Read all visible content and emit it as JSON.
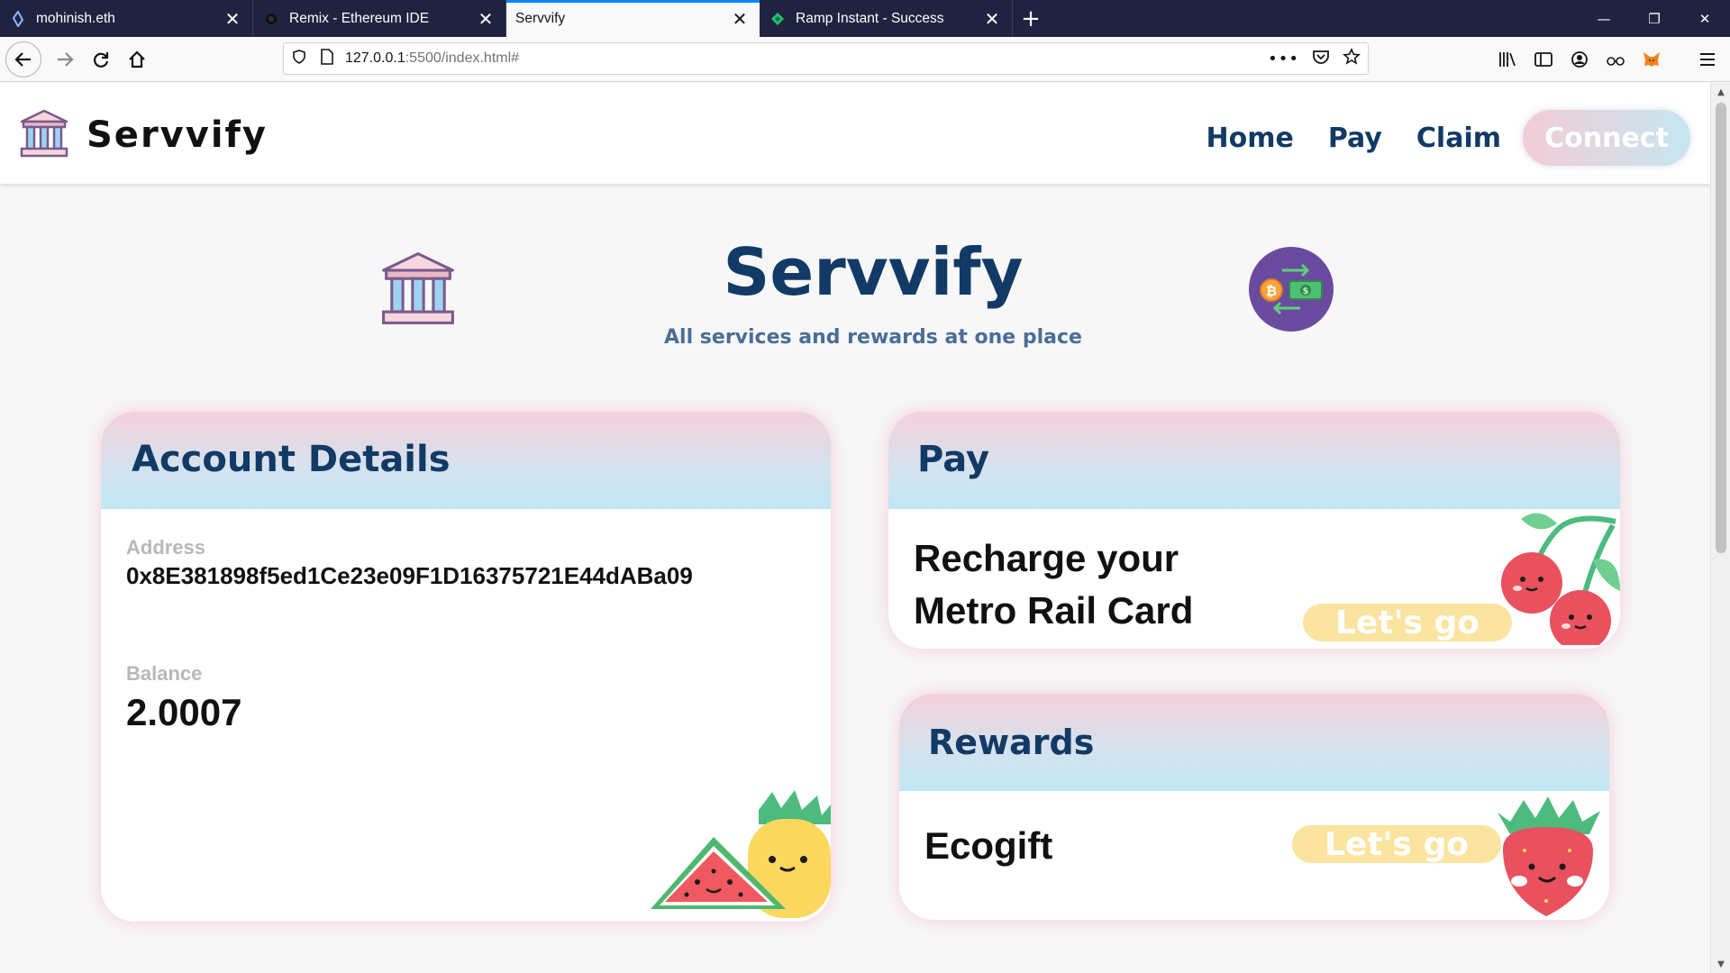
{
  "browser": {
    "tabs": [
      {
        "title": "mohinish.eth",
        "active": false
      },
      {
        "title": "Remix - Ethereum IDE",
        "active": false
      },
      {
        "title": "Servvify",
        "active": true
      },
      {
        "title": "Ramp Instant - Success",
        "active": false
      }
    ],
    "url": {
      "host": "127.0.0.1",
      "rest": ":5500/index.html#"
    }
  },
  "site": {
    "brand": "Servvify",
    "nav": {
      "home": "Home",
      "pay": "Pay",
      "claim": "Claim",
      "connect": "Connect"
    },
    "hero": {
      "title": "Servvify",
      "subtitle": "All services and rewards at one place"
    }
  },
  "account": {
    "title": "Account Details",
    "address_label": "Address",
    "address": "0x8E381898f5ed1Ce23e09F1D16375721E44dABa09",
    "balance_label": "Balance",
    "balance": "2.0007"
  },
  "pay": {
    "title": "Pay",
    "item_line1": "Recharge your",
    "item_line2": "Metro Rail Card",
    "button": "Let's go"
  },
  "rewards": {
    "title": "Rewards",
    "item": "Ecogift",
    "button": "Let's go"
  },
  "colors": {
    "brand_navy": "#123a66",
    "tab_bar": "#202340",
    "accent_blue": "#0a84ff"
  }
}
